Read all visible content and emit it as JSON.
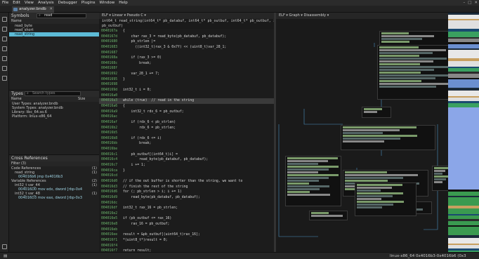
{
  "menu": [
    "File",
    "Edit",
    "View",
    "Analysis",
    "Debugger",
    "Plugins",
    "Window",
    "Help"
  ],
  "tab": {
    "name": "analyzer.bndb"
  },
  "symbols": {
    "title": "Symbols",
    "search": "read",
    "column": "Name",
    "items": [
      "read_byte",
      "read_short",
      "read_string"
    ],
    "selected": 2
  },
  "types": {
    "title": "Types",
    "placeholder": "Search types",
    "col_name": "Name",
    "col_size": "Size",
    "items": [
      "User Types: analyzer.bndb",
      "System Types: analyzer.bndb",
      "Library: libc_64.so.6",
      "Platform: linux-x86_64"
    ]
  },
  "xrefs": {
    "title": "Cross References",
    "filter": "Filter (3)",
    "rows": [
      {
        "t": "Code References",
        "c": "(1)",
        "lvl": 0
      },
      {
        "t": "read_string",
        "c": "(1)",
        "lvl": 1
      },
      {
        "t": "004016b6 jmp      0x4016b3",
        "c": "",
        "lvl": 2
      },
      {
        "t": "Variable References",
        "c": "(2)",
        "lvl": 0
      },
      {
        "t": "int32_t var_44",
        "c": "(1)",
        "lvl": 1
      },
      {
        "t": "004016D0 mov     edx, dword [rbp-0x4",
        "c": "",
        "lvl": 2
      },
      {
        "t": "int32_t var_48",
        "c": "(1)",
        "lvl": 1
      },
      {
        "t": "004016D3 mov     eax, dword [rbp-0x3",
        "c": "",
        "lvl": 2
      }
    ]
  },
  "left_view": {
    "header": "ELF ▾  Linear ▾  Pseudo C ▾",
    "signature": [
      "int64_t read_string(int64_t* pb_databuf, int64_t* pb_outbuf, int64_t* pb_outbuf, int32_t",
      "        pb_outbuf)"
    ]
  },
  "code_lines": [
    {
      "a": "0040167a",
      "t": "{"
    },
    {
      "a": "0040167d",
      "t": "    char rax_3 = read_byte(pb_databuf, pb_databuf);"
    },
    {
      "a": "00401680",
      "t": "    pb_strlen |="
    },
    {
      "a": "00401683",
      "t": "      ((int32_t)rax_3 & 0x7f) << (uint8_t)var_28_1;"
    },
    {
      "a": "00401687",
      "t": ""
    },
    {
      "a": "0040168a",
      "t": "    if (rax_3 >= 0)"
    },
    {
      "a": "0040168c",
      "t": "        break;"
    },
    {
      "a": "0040168f",
      "t": ""
    },
    {
      "a": "00401692",
      "t": "    var_28_1 += 7;"
    },
    {
      "a": "00401695",
      "t": "}"
    },
    {
      "a": "00401698",
      "t": ""
    },
    {
      "a": "0040169d",
      "t": "int32_t i = 0;"
    },
    {
      "a": "004016a0",
      "t": ""
    },
    {
      "a": "004016a3",
      "t": "while (true)  // read in the string",
      "hl": true
    },
    {
      "a": "004016a6",
      "t": "{"
    },
    {
      "a": "004016a9",
      "t": "    int32_t rdx_6 = pb_outbuf;"
    },
    {
      "a": "004016ac",
      "t": ""
    },
    {
      "a": "004016af",
      "t": "    if (rdx_6 < pb_strlen)"
    },
    {
      "a": "004016b2",
      "t": "        rdx_6 = pb_strlen;"
    },
    {
      "a": "004016b5",
      "t": ""
    },
    {
      "a": "004016b8",
      "t": "    if (rdx_6 <= i)"
    },
    {
      "a": "004016bb",
      "t": "        break;"
    },
    {
      "a": "004016be",
      "t": ""
    },
    {
      "a": "004016c1",
      "t": "    pb_outbuf[(int64_t)i] ="
    },
    {
      "a": "004016c4",
      "t": "        read_byte(pb_databuf, pb_databuf);"
    },
    {
      "a": "004016c7",
      "t": "    i += 1;"
    },
    {
      "a": "004016ca",
      "t": "}"
    },
    {
      "a": "004016cd",
      "t": ""
    },
    {
      "a": "004016d0",
      "t": "// if the out buffer is shorter than the string, we want to"
    },
    {
      "a": "004016d3",
      "t": "// finish the rest of the string"
    },
    {
      "a": "004016d6",
      "t": "for (; pb_strlen > i; i += 1)"
    },
    {
      "a": "004016d9",
      "t": "    read_byte(pb_databuf, pb_databuf);"
    },
    {
      "a": "004016dc",
      "t": ""
    },
    {
      "a": "004016df",
      "t": "int32_t rax_16 = pb_strlen;"
    },
    {
      "a": "004016e2",
      "t": ""
    },
    {
      "a": "004016e5",
      "t": "if (pb_outbuf <= rax_16)"
    },
    {
      "a": "004016e8",
      "t": "    rax_16 = pb_outbuf;"
    },
    {
      "a": "004016eb",
      "t": ""
    },
    {
      "a": "004016ee",
      "t": "result = &pb_outbuf[(uint64_t)rax_16];"
    },
    {
      "a": "004016f1",
      "t": "*(uint8_t*)result = 0;"
    },
    {
      "a": "004016f4",
      "t": ""
    },
    {
      "a": "004016f7",
      "t": "return result;"
    }
  ],
  "right_view": {
    "header": "ELF ▾  Graph ▾  Disassembly ▾"
  },
  "status": {
    "platform": "linux-x86_64",
    "range": "0x4016b3-0x4016b6 (0x3 bytes)"
  },
  "colors": {
    "accent": "#5dbbd6",
    "highlight": "#3a3a3a"
  }
}
